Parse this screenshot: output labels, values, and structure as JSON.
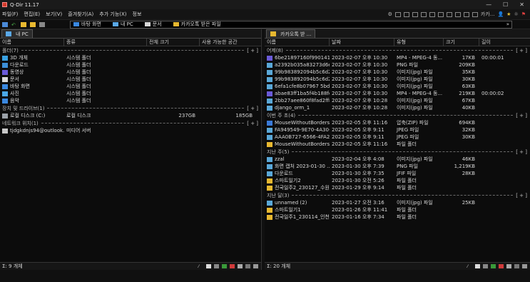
{
  "window": {
    "title": "Q-Dir 11.17",
    "min": "—",
    "max": "☐",
    "close": "✕"
  },
  "menu": [
    "파일(F)",
    "편집(E)",
    "보기(V)",
    "즐겨찾기(A)",
    "추가 기능(X)",
    "정보"
  ],
  "menu_right": {
    "label": "카카..."
  },
  "favorites": [
    "바탕 화면",
    "내 PC",
    "문서",
    "카카오톡 받은 파일"
  ],
  "left": {
    "tab": "내 PC",
    "columns": [
      "이름",
      "종류",
      "전체 크기",
      "사용 가능한 공간"
    ],
    "groups": [
      {
        "label": "폴더(7)",
        "tag": "[ + ]",
        "items": [
          {
            "name": "3D 개체",
            "type": "시스템 폴더",
            "total": "",
            "free": "",
            "icon": "3d-folder-icon",
            "color": "#39a0e0"
          },
          {
            "name": "다운로드",
            "type": "시스템 폴더",
            "total": "",
            "free": "",
            "icon": "download-folder-icon",
            "color": "#3c8fd8"
          },
          {
            "name": "동영상",
            "type": "시스템 폴더",
            "total": "",
            "free": "",
            "icon": "video-folder-icon",
            "color": "#6a5ad8"
          },
          {
            "name": "문서",
            "type": "시스템 폴더",
            "total": "",
            "free": "",
            "icon": "document-folder-icon",
            "color": "#d8d8d8"
          },
          {
            "name": "바탕 화면",
            "type": "시스템 폴더",
            "total": "",
            "free": "",
            "icon": "desktop-folder-icon",
            "color": "#3a88e0"
          },
          {
            "name": "사진",
            "type": "시스템 폴더",
            "total": "",
            "free": "",
            "icon": "pictures-folder-icon",
            "color": "#4aa8e8"
          },
          {
            "name": "음악",
            "type": "시스템 폴더",
            "total": "",
            "free": "",
            "icon": "music-folder-icon",
            "color": "#3a88e0"
          }
        ]
      },
      {
        "label": "장치 및 드라이브(1)",
        "tag": "[ + ]",
        "items": [
          {
            "name": "로컬 디스크 (C:)",
            "type": "로컬 디스크",
            "total": "237GB",
            "free": "185GB",
            "icon": "drive-icon",
            "color": "#9aa0a8"
          }
        ]
      },
      {
        "label": "네트워크 위치(1)",
        "tag": "[ + ]",
        "items": [
          {
            "name": "tjdgkdnjs94@outlook...",
            "type": "미디어 서버",
            "total": "",
            "free": "",
            "icon": "media-server-icon",
            "color": "#c8c8c8"
          }
        ]
      }
    ],
    "status": "9 개체"
  },
  "right": {
    "tab": "카카오톡 받 ...",
    "columns": [
      "이름",
      "날짜",
      "유형",
      "크기",
      "길이"
    ],
    "groups": [
      {
        "label": "어제(8)",
        "tag": "[ + ]",
        "items": [
          {
            "name": "6be21897160f990141 0c...",
            "date": "2023-02-07 오후 10:30",
            "type": "MP4 - MPEG-4 동...",
            "size": "17KB",
            "len": "00:00:01",
            "icon": "video-file-icon",
            "color": "#6a5ad8"
          },
          {
            "name": "a2392b035a83273d6e...",
            "date": "2023-02-07 오후 10:30",
            "type": "PNG 파일",
            "size": "209KB",
            "len": "",
            "icon": "image-file-icon",
            "color": "#5aa8d8"
          },
          {
            "name": "99b983892094b5c6d2f...",
            "date": "2023-02-07 오후 10:30",
            "type": "이미지(jpg) 파일",
            "size": "35KB",
            "len": "",
            "icon": "image-file-icon",
            "color": "#5aa8d8"
          },
          {
            "name": "99b983892094b5c6d2f...",
            "date": "2023-02-07 오후 10:30",
            "type": "이미지(jpg) 파일",
            "size": "30KB",
            "len": "",
            "icon": "image-file-icon",
            "color": "#5aa8d8"
          },
          {
            "name": "6efa1cfe8b07967 5bdb0...",
            "date": "2023-02-07 오후 10:30",
            "type": "이미지(jpg) 파일",
            "size": "63KB",
            "len": "",
            "icon": "image-file-icon",
            "color": "#5aa8d8"
          },
          {
            "name": "abae83ff1ba5f4b188fc...",
            "date": "2023-02-07 오후 10:30",
            "type": "MP4 - MPEG-4 동...",
            "size": "219KB",
            "len": "00:00:02",
            "icon": "video-file-icon",
            "color": "#6a5ad8"
          },
          {
            "name": "2bb27aee860f8fad2ff8...",
            "date": "2023-02-07 오후 10:28",
            "type": "이미지(jpg) 파일",
            "size": "67KB",
            "len": "",
            "icon": "image-file-icon",
            "color": "#5aa8d8"
          },
          {
            "name": "django_orm_1",
            "date": "2023-02-07 오후 10:28",
            "type": "이미지(jpg) 파일",
            "size": "40KB",
            "len": "",
            "icon": "image-file-icon",
            "color": "#5aa8d8"
          }
        ]
      },
      {
        "label": "이번 주 초(4)",
        "tag": "[ + ]",
        "items": [
          {
            "name": "MouseWithoutBorders...",
            "date": "2023-02-05 오후 11:16",
            "type": "압축(ZIP) 파일",
            "size": "694KB",
            "len": "",
            "icon": "zip-file-icon",
            "color": "#3a7ad8"
          },
          {
            "name": "FA949549-9E70-4A30-...",
            "date": "2023-02-05 오후 9:11",
            "type": "JPEG 파일",
            "size": "32KB",
            "len": "",
            "icon": "image-file-icon",
            "color": "#5aa8d8"
          },
          {
            "name": "AAA0B727-6566-4FA2-...",
            "date": "2023-02-05 오후 9:11",
            "type": "JPEG 파일",
            "size": "30KB",
            "len": "",
            "icon": "image-file-icon",
            "color": "#5aa8d8"
          },
          {
            "name": "MouseWithoutBorders...",
            "date": "2023-02-05 오후 11:16",
            "type": "파일 폴더",
            "size": "",
            "len": "",
            "icon": "folder-icon",
            "color": "#e8b830"
          }
        ]
      },
      {
        "label": "지난 주(5)",
        "tag": "[ + ]",
        "items": [
          {
            "name": "zzal",
            "date": "2023-02-04 오후 4:08",
            "type": "이미지(jpg) 파일",
            "size": "46KB",
            "len": "",
            "icon": "image-file-icon",
            "color": "#5aa8d8"
          },
          {
            "name": "화면 캡처 2023-01-30 ...",
            "date": "2023-01-30 오후 7:39",
            "type": "PNG 파일",
            "size": "1,219KB",
            "len": "",
            "icon": "image-file-icon",
            "color": "#5aa8d8"
          },
          {
            "name": "다운로드",
            "date": "2023-01-30 오후 7:35",
            "type": "JFIF 파일",
            "size": "28KB",
            "len": "",
            "icon": "image-file-icon",
            "color": "#5aa8d8"
          },
          {
            "name": "스마트일기2",
            "date": "2023-01-30 오전 5:26",
            "type": "파일 폴더",
            "size": "",
            "len": "",
            "icon": "folder-icon",
            "color": "#e8b830"
          },
          {
            "name": "전국일주2_230127_수원",
            "date": "2023-01-29 오후 9:14",
            "type": "파일 폴더",
            "size": "",
            "len": "",
            "icon": "folder-icon",
            "color": "#e8b830"
          }
        ]
      },
      {
        "label": "지난 달(3)",
        "tag": "[ + ]",
        "items": [
          {
            "name": "unnamed (2)",
            "date": "2023-01-27 오전 3:16",
            "type": "이미지(jpg) 파일",
            "size": "25KB",
            "len": "",
            "icon": "image-file-icon",
            "color": "#5aa8d8"
          },
          {
            "name": "스마트일기1",
            "date": "2023-01-26 오후 11:41",
            "type": "파일 폴더",
            "size": "",
            "len": "",
            "icon": "folder-icon",
            "color": "#e8b830"
          },
          {
            "name": "전국일주1_230114_인천",
            "date": "2023-01-16 오후 7:34",
            "type": "파일 폴더",
            "size": "",
            "len": "",
            "icon": "folder-icon",
            "color": "#e8b830"
          }
        ]
      }
    ],
    "status": "20 개체"
  }
}
